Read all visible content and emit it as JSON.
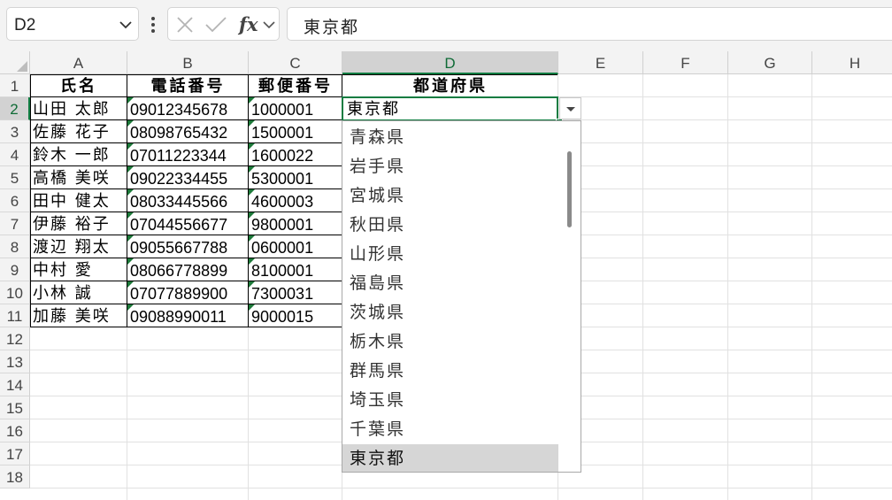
{
  "formula_bar": {
    "name_box": "D2",
    "icons": [
      "chevron-down-icon",
      "more-vertical-icon",
      "cancel-icon",
      "enter-checkmark-icon",
      "insert-function-icon"
    ],
    "fx_label": "fx",
    "formula": "東京都"
  },
  "columns": [
    "A",
    "B",
    "C",
    "D",
    "E",
    "F",
    "G",
    "H"
  ],
  "rows": [
    "1",
    "2",
    "3",
    "4",
    "5",
    "6",
    "7",
    "8",
    "9",
    "10",
    "11",
    "12",
    "13",
    "14",
    "15",
    "16",
    "17",
    "18"
  ],
  "active": {
    "column": "D",
    "row": "2"
  },
  "table": {
    "headers": [
      "氏名",
      "電話番号",
      "郵便番号",
      "都道府県"
    ],
    "rows": [
      [
        "山田 太郎",
        "09012345678",
        "1000001",
        "東京都"
      ],
      [
        "佐藤 花子",
        "08098765432",
        "1500001",
        ""
      ],
      [
        "鈴木 一郎",
        "07011223344",
        "1600022",
        ""
      ],
      [
        "高橋 美咲",
        "09022334455",
        "5300001",
        ""
      ],
      [
        "田中 健太",
        "08033445566",
        "4600003",
        ""
      ],
      [
        "伊藤 裕子",
        "07044556677",
        "9800001",
        ""
      ],
      [
        "渡辺 翔太",
        "09055667788",
        "0600001",
        ""
      ],
      [
        "中村 愛",
        "08066778899",
        "8100001",
        ""
      ],
      [
        "小林 誠",
        "07077889900",
        "7300031",
        ""
      ],
      [
        "加藤 美咲",
        "09088990011",
        "9000015",
        ""
      ]
    ]
  },
  "dropdown": {
    "items": [
      "青森県",
      "岩手県",
      "宮城県",
      "秋田県",
      "山形県",
      "福島県",
      "茨城県",
      "栃木県",
      "群馬県",
      "埼玉県",
      "千葉県",
      "東京都"
    ],
    "selected": "東京都"
  },
  "colors": {
    "accent": "#107c41",
    "error_triangle": "#1d7a3a",
    "header_bg": "#f3f3f3"
  }
}
